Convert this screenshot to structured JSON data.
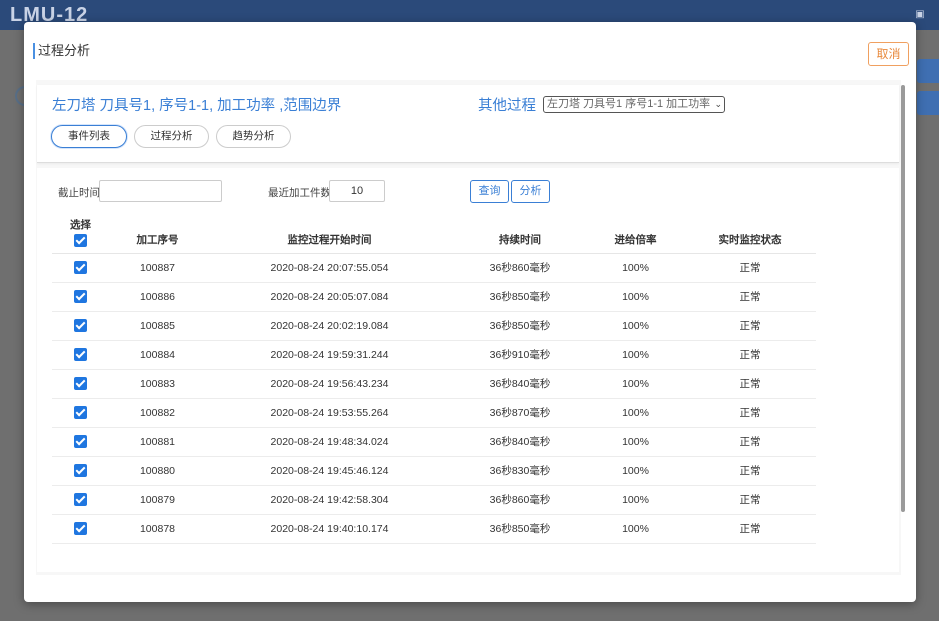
{
  "background": {
    "app_title": "LMU-12"
  },
  "modal": {
    "title": "过程分析",
    "cancel_label": "取消"
  },
  "info": {
    "tool_title": "左刀塔  刀具号1,  序号1-1,  加工功率  ,范围边界",
    "other_label": "其他过程",
    "other_select_value": "左刀塔 刀具号1 序号1-1 加工功率"
  },
  "tabs": [
    {
      "label": "事件列表",
      "active": true
    },
    {
      "label": "过程分析",
      "active": false
    },
    {
      "label": "趋势分析",
      "active": false
    }
  ],
  "filters": {
    "cutoff_label": "截止时间",
    "cutoff_value": "",
    "recent_label": "最近加工件数",
    "recent_value": "10",
    "query_label": "查询",
    "analyze_label": "分析"
  },
  "table": {
    "select_header": "选择",
    "headers": [
      "加工序号",
      "监控过程开始时间",
      "持续时间",
      "进给倍率",
      "实时监控状态"
    ],
    "rows": [
      {
        "seq": "100887",
        "start": "2020-08-24 20:07:55.054",
        "duration": "36秒860毫秒",
        "feed": "100%",
        "status": "正常"
      },
      {
        "seq": "100886",
        "start": "2020-08-24 20:05:07.084",
        "duration": "36秒850毫秒",
        "feed": "100%",
        "status": "正常"
      },
      {
        "seq": "100885",
        "start": "2020-08-24 20:02:19.084",
        "duration": "36秒850毫秒",
        "feed": "100%",
        "status": "正常"
      },
      {
        "seq": "100884",
        "start": "2020-08-24 19:59:31.244",
        "duration": "36秒910毫秒",
        "feed": "100%",
        "status": "正常"
      },
      {
        "seq": "100883",
        "start": "2020-08-24 19:56:43.234",
        "duration": "36秒840毫秒",
        "feed": "100%",
        "status": "正常"
      },
      {
        "seq": "100882",
        "start": "2020-08-24 19:53:55.264",
        "duration": "36秒870毫秒",
        "feed": "100%",
        "status": "正常"
      },
      {
        "seq": "100881",
        "start": "2020-08-24 19:48:34.024",
        "duration": "36秒840毫秒",
        "feed": "100%",
        "status": "正常"
      },
      {
        "seq": "100880",
        "start": "2020-08-24 19:45:46.124",
        "duration": "36秒830毫秒",
        "feed": "100%",
        "status": "正常"
      },
      {
        "seq": "100879",
        "start": "2020-08-24 19:42:58.304",
        "duration": "36秒860毫秒",
        "feed": "100%",
        "status": "正常"
      },
      {
        "seq": "100878",
        "start": "2020-08-24 19:40:10.174",
        "duration": "36秒850毫秒",
        "feed": "100%",
        "status": "正常"
      }
    ]
  }
}
